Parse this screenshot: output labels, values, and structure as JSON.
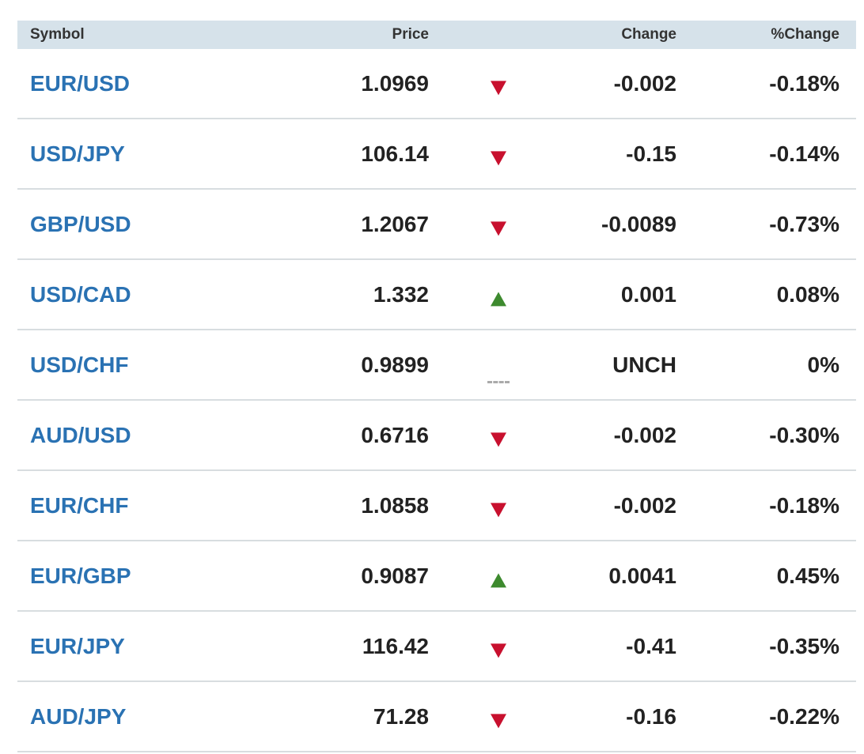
{
  "table": {
    "headers": {
      "symbol": "Symbol",
      "price": "Price",
      "change": "Change",
      "pct_change": "%Change"
    },
    "rows": [
      {
        "symbol": "EUR/USD",
        "price": "1.0969",
        "direction": "down",
        "change": "-0.002",
        "pct_change": "-0.18%"
      },
      {
        "symbol": "USD/JPY",
        "price": "106.14",
        "direction": "down",
        "change": "-0.15",
        "pct_change": "-0.14%"
      },
      {
        "symbol": "GBP/USD",
        "price": "1.2067",
        "direction": "down",
        "change": "-0.0089",
        "pct_change": "-0.73%"
      },
      {
        "symbol": "USD/CAD",
        "price": "1.332",
        "direction": "up",
        "change": "0.001",
        "pct_change": "0.08%"
      },
      {
        "symbol": "USD/CHF",
        "price": "0.9899",
        "direction": "none",
        "change": "UNCH",
        "pct_change": "0%"
      },
      {
        "symbol": "AUD/USD",
        "price": "0.6716",
        "direction": "down",
        "change": "-0.002",
        "pct_change": "-0.30%"
      },
      {
        "symbol": "EUR/CHF",
        "price": "1.0858",
        "direction": "down",
        "change": "-0.002",
        "pct_change": "-0.18%"
      },
      {
        "symbol": "EUR/GBP",
        "price": "0.9087",
        "direction": "up",
        "change": "0.0041",
        "pct_change": "0.45%"
      },
      {
        "symbol": "EUR/JPY",
        "price": "116.42",
        "direction": "down",
        "change": "-0.41",
        "pct_change": "-0.35%"
      },
      {
        "symbol": "AUD/JPY",
        "price": "71.28",
        "direction": "down",
        "change": "-0.16",
        "pct_change": "-0.22%"
      }
    ]
  },
  "colors": {
    "header_bg": "#d6e2ea",
    "symbol_link": "#2a72b3",
    "down_arrow": "#c8102e",
    "up_arrow": "#3d8a2e",
    "row_divider": "#d8dde0"
  }
}
